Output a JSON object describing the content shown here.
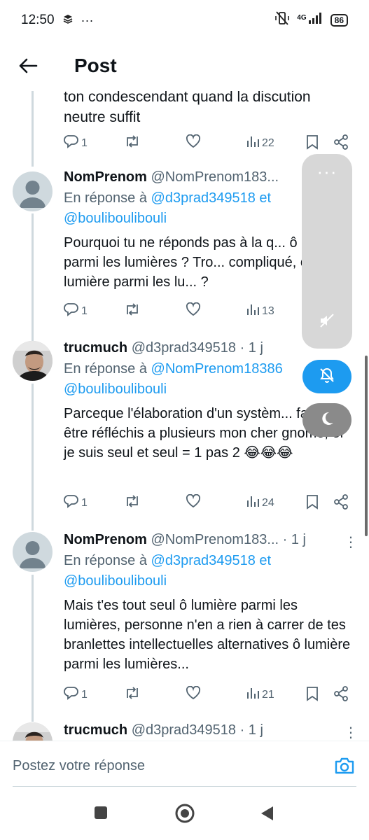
{
  "status_bar": {
    "time": "12:50",
    "network": "4G",
    "battery": "86"
  },
  "header": {
    "title": "Post"
  },
  "partial_tweet": {
    "text": "ton condescendant quand la discution neutre suffit",
    "replies": "1",
    "views": "22"
  },
  "tweets": [
    {
      "name": "NomPrenom",
      "handle": "@NomPrenom183...",
      "time": "",
      "reply_prefix": "En réponse à ",
      "reply_to_1": "@d3prad349518",
      "reply_join": " et",
      "reply_to_2": "@bouliboulibouli",
      "text": "Pourquoi tu ne réponds pas à la q... ô lumière parmi les lumières ? Tro... compliqué, ô lumière parmi les lu... ?",
      "replies": "1",
      "views": "13"
    },
    {
      "name": "trucmuch",
      "handle": "@d3prad349518",
      "time": "· 1 j",
      "reply_prefix": "En réponse à ",
      "reply_to_1": "@NomPrenom18386",
      "reply_join": "",
      "reply_to_2": "@bouliboulibouli",
      "text": "Parceque l'élaboration d'un systèm... fait pour être réfléchis a plusieurs mon cher gnome, or je suis seul et seul = 1 pas 2 😂😂😂",
      "replies": "1",
      "views": "24"
    },
    {
      "name": "NomPrenom",
      "handle": "@NomPrenom183...",
      "time": "· 1 j",
      "reply_prefix": "En réponse à ",
      "reply_to_1": "@d3prad349518",
      "reply_join": " et",
      "reply_to_2": "@bouliboulibouli",
      "text": "Mais t'es tout seul ô lumière parmi les lumières, personne n'en a rien à carrer de tes branlettes intellectuelles alternatives ô lumière parmi les lumières...",
      "replies": "1",
      "views": "21"
    },
    {
      "name": "trucmuch",
      "handle": "@d3prad349518",
      "time": "· 1 j"
    }
  ],
  "compose": {
    "placeholder": "Postez votre réponse"
  },
  "colors": {
    "accent": "#1d9bf0",
    "text": "#0f1419",
    "muted": "#536471",
    "line": "#cfd9de"
  }
}
